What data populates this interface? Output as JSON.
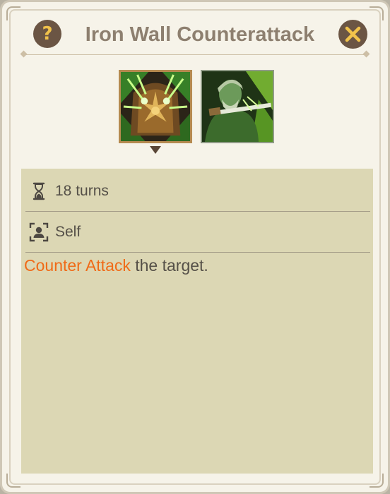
{
  "dialog": {
    "title": "Iron Wall Counterattack",
    "help_icon": "question-mark-icon",
    "close_icon": "close-x-icon"
  },
  "skills": [
    {
      "icon": "armored-guardian-skill-icon",
      "selected": true
    },
    {
      "icon": "swordsman-skill-icon",
      "selected": false
    }
  ],
  "details": {
    "duration": {
      "icon": "hourglass-icon",
      "text": "18 turns"
    },
    "target": {
      "icon": "self-target-icon",
      "text": "Self"
    },
    "description": {
      "keyword": "Counter Attack",
      "rest": " the target."
    }
  },
  "colors": {
    "keyword": "#f06a17",
    "title": "#8d7f6f",
    "body_text": "#555048",
    "info_background": "#dcd7b4",
    "panel_background": "#f6f3e9",
    "button_background": "#6b5544",
    "help_glyph": "#f1c24b"
  }
}
